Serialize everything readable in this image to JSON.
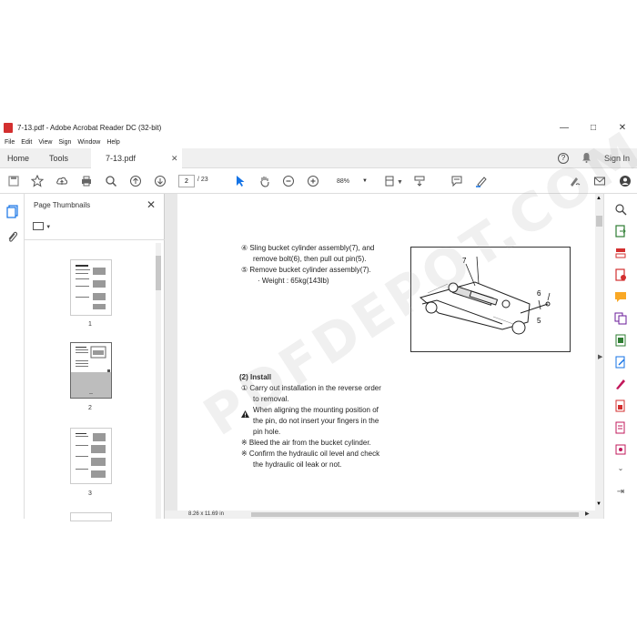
{
  "window": {
    "title": "7-13.pdf - Adobe Acrobat Reader DC (32-bit)"
  },
  "menu": [
    "File",
    "Edit",
    "View",
    "Sign",
    "Window",
    "Help"
  ],
  "tabs": {
    "home": "Home",
    "tools": "Tools",
    "document": "7-13.pdf"
  },
  "sign_in": "Sign In",
  "toolbar": {
    "page_current": "2",
    "page_total": "/ 23",
    "zoom": "88%"
  },
  "panel": {
    "title": "Page Thumbnails",
    "thumbnails": [
      "1",
      "2",
      "3"
    ]
  },
  "document": {
    "step4_a": "④ Sling bucket cylinder assembly(7), and",
    "step4_b": "remove bolt(6), then pull out pin(5).",
    "step5": "⑤ Remove bucket cylinder assembly(7).",
    "weight": "· Weight : 65kg(143lb)",
    "figure_labels": {
      "seven": "7",
      "six": "6",
      "five": "5"
    },
    "install_heading": "(2) Install",
    "install_1a": "① Carry out installation in the reverse order",
    "install_1b": "to removal.",
    "warning_a": "When aligning the mounting position of",
    "warning_b": "the pin, do not insert your fingers in the",
    "warning_c": "pin hole.",
    "note1": "※ Bleed the air from the bucket cylinder.",
    "note2a": "※ Confirm the hydraulic oil level and check",
    "note2b": "the hydraulic oil leak or not."
  },
  "status": {
    "page_size": "8.26 x 11.69 in"
  },
  "watermark": "PDFDEPOT.COM",
  "colors": {
    "accent": "#1473e6",
    "danger": "#d32f2f"
  }
}
